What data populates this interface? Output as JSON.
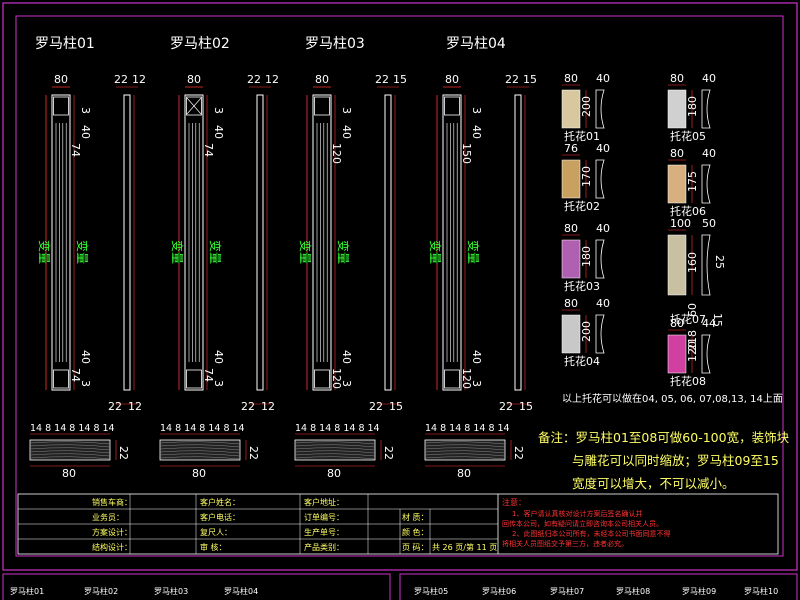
{
  "columns": [
    {
      "title": "罗马柱01",
      "top_width": "80",
      "side_w1": "22",
      "side_w2": "12",
      "side_top": "3",
      "len_top": "40",
      "len_mid": "74",
      "var_left": "变量",
      "var_right": "变量",
      "len_low": "40",
      "len_bot": "74",
      "bot_3": "3",
      "bot_w1": "22",
      "bot_w2": "12"
    },
    {
      "title": "罗马柱02",
      "top_width": "80",
      "side_w1": "22",
      "side_w2": "12",
      "side_top": "3",
      "len_top": "40",
      "len_mid": "74",
      "var_left": "变量",
      "var_right": "变量",
      "len_low": "40",
      "len_bot": "74",
      "bot_3": "3",
      "bot_w1": "22",
      "bot_w2": "12"
    },
    {
      "title": "罗马柱03",
      "top_width": "80",
      "side_w1": "22",
      "side_w2": "15",
      "side_top": "3",
      "len_top": "40",
      "len_mid": "120",
      "var_left": "变量",
      "var_right": "变量",
      "len_low": "40",
      "len_bot": "120",
      "bot_3": "3",
      "bot_w1": "22",
      "bot_w2": "15"
    },
    {
      "title": "罗马柱04",
      "top_width": "80",
      "side_w1": "22",
      "side_w2": "15",
      "side_top": "3",
      "len_top": "40",
      "len_mid": "150",
      "var_left": "变量",
      "var_right": "变量",
      "len_low": "40",
      "len_bot": "120",
      "bot_3": "3",
      "bot_w1": "22",
      "bot_w2": "15"
    }
  ],
  "profiles": [
    {
      "top": "14 8 14 8 14 8 14",
      "width": "80",
      "height": "22"
    },
    {
      "top": "14 8 14 8 14 8 14",
      "width": "80",
      "height": "22"
    },
    {
      "top": "14 8 14 8 14 8 14",
      "width": "80",
      "height": "22"
    },
    {
      "top": "14 8 14 8 14 8 14",
      "width": "80",
      "height": "22"
    }
  ],
  "brackets": [
    {
      "label": "托花01",
      "w": "80",
      "h": "200",
      "d": "40"
    },
    {
      "label": "托花02",
      "w": "76",
      "h": "170",
      "d": "40"
    },
    {
      "label": "托花03",
      "w": "80",
      "h": "180",
      "d": "40"
    },
    {
      "label": "托花04",
      "w": "80",
      "h": "200",
      "d": "40"
    },
    {
      "label": "托花05",
      "w": "80",
      "h": "180",
      "d": "40"
    },
    {
      "label": "托花06",
      "w": "80",
      "h": "175",
      "d": "40"
    },
    {
      "label": "托花07",
      "w": "100",
      "h": "160",
      "h2": "60",
      "h3": "218",
      "d": "50",
      "d2": "25",
      "d3": "15"
    },
    {
      "label": "托花08",
      "w": "80",
      "h": "120",
      "d": "44"
    }
  ],
  "bracket_note": "以上托花可以做在04, 05, 06, 07,08,13, 14上面",
  "remark": {
    "line1": "备注：罗马柱01至08可做60-100宽，装饰块",
    "line2": "与雕花可以同时缩放；罗马柱09至15",
    "line3": "宽度可以增大，不可以减小。"
  },
  "title_block": {
    "row1": [
      "销售车商：",
      "客户姓名：",
      "客户地址："
    ],
    "row2": [
      "业务员：",
      "客户电话：",
      "订单编号：",
      "材    质："
    ],
    "row3": [
      "方案设计：",
      "复尺人：",
      "生产单号：",
      "颜    色："
    ],
    "row4": [
      "结构设计：",
      "审    核：",
      "产品类别：",
      "页    码："
    ],
    "page_info": "共  26  页/第  11  页",
    "note_title": "注意：",
    "note_line1": "1、客户请认真核对设计方案后签名确认并",
    "note_line2": "回传本公司，如有疑问请立即咨询本公司相关人员。",
    "note_line3": "2、此图纸归本公司所有，未经本公司书面同意不得",
    "note_line4": "将相关人员图纸交予第三方，违者必究。"
  },
  "bottom_left": [
    "罗马柱01",
    "罗马柱02",
    "罗马柱03",
    "罗马柱04"
  ],
  "bottom_right": [
    "罗马柱05",
    "罗马柱06",
    "罗马柱07",
    "罗马柱08",
    "罗马柱09",
    "罗马柱10"
  ],
  "colors": {
    "frame": "#cc33cc",
    "dim": "#ff3333",
    "green": "#33ff33",
    "cyan": "#33ffff",
    "text": "#ffffff",
    "note": "#ffff66"
  }
}
